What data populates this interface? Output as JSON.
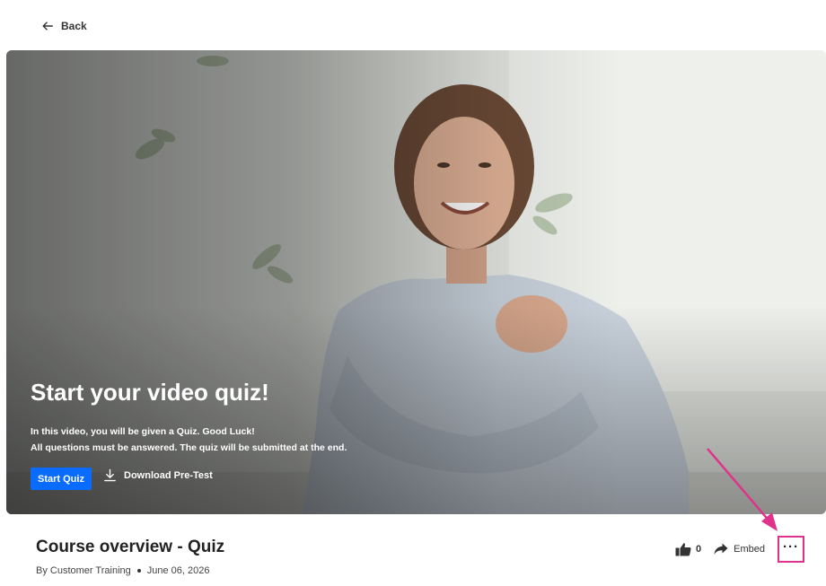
{
  "nav": {
    "back_label": "Back"
  },
  "hero": {
    "title": "Start your video quiz!",
    "line1": "In this video, you will be given a Quiz. Good Luck!",
    "line2": "All questions must be answered. The quiz will be submitted at the end.",
    "start_button": "Start Quiz",
    "download_label": "Download Pre-Test",
    "accent": "#0a6cff"
  },
  "media": {
    "title": "Course overview - Quiz",
    "author": "By Customer Training",
    "date": "June 06, 2026"
  },
  "actions": {
    "like_count": "0",
    "embed_label": "Embed",
    "more_label": "···",
    "highlight_color": "#e0328a"
  }
}
